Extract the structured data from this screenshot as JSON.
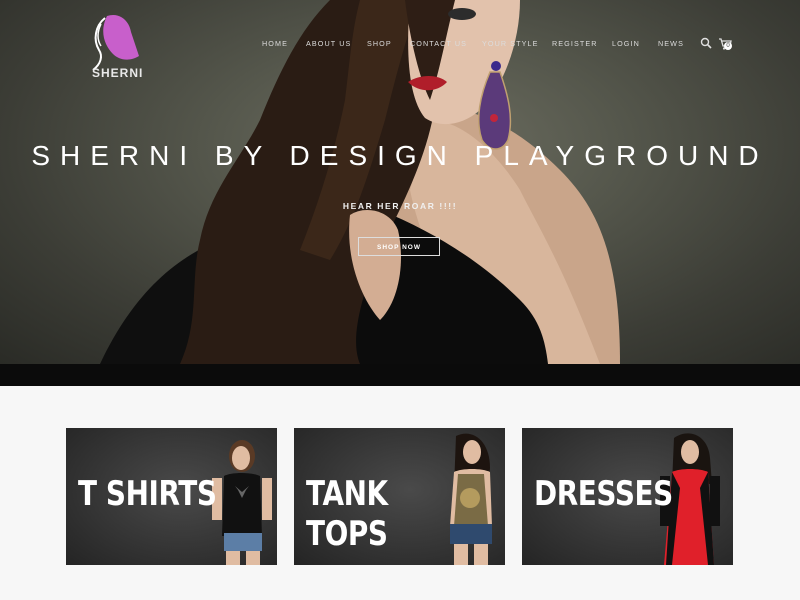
{
  "brand": {
    "name": "SHERNI",
    "logo_color": "#c85fcb"
  },
  "nav": {
    "items": [
      "HOME",
      "ABOUT US",
      "SHOP",
      "CONTACT US",
      "YOUR STYLE",
      "REGISTER",
      "LOGIN",
      "NEWS"
    ],
    "search_icon": "search-icon",
    "cart_icon": "cart-icon",
    "cart_count": "0"
  },
  "hero": {
    "title": "SHERNI BY DESIGN PLAYGROUND",
    "subtitle": "HEAR HER ROAR !!!!",
    "cta_label": "SHOP NOW"
  },
  "categories": [
    {
      "label": "T SHIRTS",
      "garment_color": "#111111"
    },
    {
      "label": "TANK TOPS",
      "garment_color": "#7a6b45"
    },
    {
      "label": "DRESSES",
      "garment_color": "#e0202a"
    }
  ]
}
